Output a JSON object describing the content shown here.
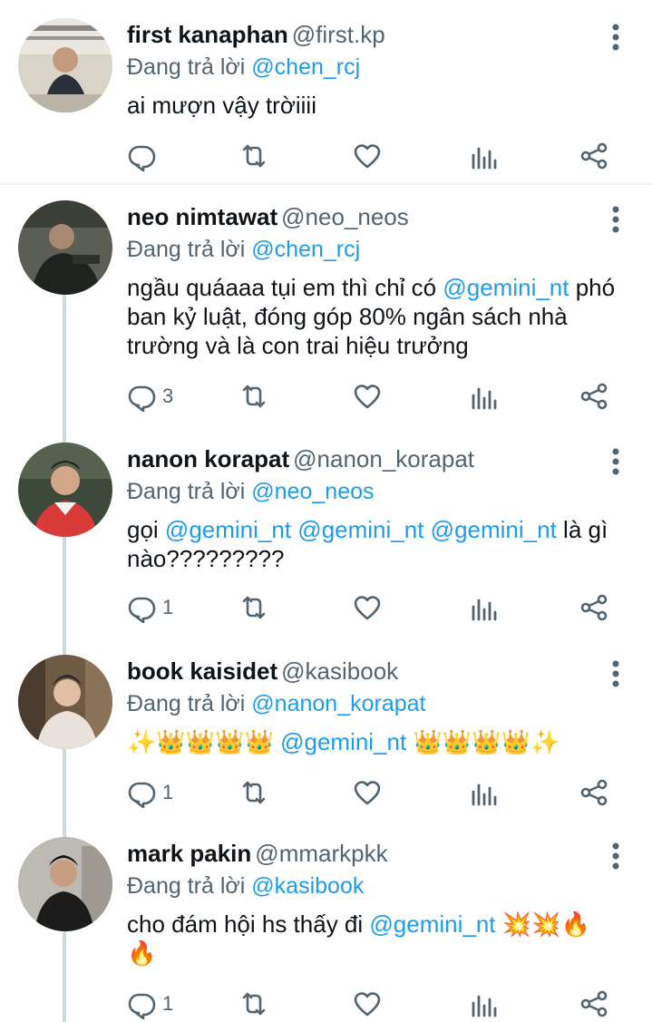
{
  "reply_prefix": "Đang trả lời",
  "tweets": [
    {
      "name": "first kanaphan",
      "handle": "@first.kp",
      "replying_to": "@chen_rcj",
      "text_parts": [
        {
          "t": "ai mượn vậy trờiiii",
          "m": false
        }
      ],
      "reply_count": "",
      "avatar_colors": [
        "#d9d4c8",
        "#2b2f3a"
      ]
    },
    {
      "name": "neo nimtawat",
      "handle": "@neo_neos",
      "replying_to": "@chen_rcj",
      "text_parts": [
        {
          "t": "ngầu quáaaa tụi em thì chỉ có ",
          "m": false
        },
        {
          "t": "@gemini_nt",
          "m": true
        },
        {
          "t": " phó ban kỷ luật, đóng góp 80% ngân sách nhà trường và là con trai hiệu trưởng",
          "m": false
        }
      ],
      "reply_count": "3",
      "avatar_colors": [
        "#5b5e55",
        "#1f2320"
      ]
    },
    {
      "name": "nanon korapat",
      "handle": "@nanon_korapat",
      "replying_to": "@neo_neos",
      "text_parts": [
        {
          "t": "gọi ",
          "m": false
        },
        {
          "t": "@gemini_nt",
          "m": true
        },
        {
          "t": " ",
          "m": false
        },
        {
          "t": "@gemini_nt",
          "m": true
        },
        {
          "t": " ",
          "m": false
        },
        {
          "t": "@gemini_nt",
          "m": true
        },
        {
          "t": " là gì nào?????????",
          "m": false
        }
      ],
      "reply_count": "1",
      "avatar_colors": [
        "#3d4a3a",
        "#d93a3a"
      ]
    },
    {
      "name": "book kaisidet",
      "handle": "@kasibook",
      "replying_to": "@nanon_korapat",
      "text_parts": [
        {
          "t": "✨👑👑👑👑 ",
          "m": false
        },
        {
          "t": "@gemini_nt",
          "m": true
        },
        {
          "t": " 👑👑👑👑✨",
          "m": false
        }
      ],
      "reply_count": "1",
      "avatar_colors": [
        "#6f5a44",
        "#e8e2da"
      ]
    },
    {
      "name": "mark pakin",
      "handle": "@mmarkpkk",
      "replying_to": "@kasibook",
      "text_parts": [
        {
          "t": "cho đám hội hs thấy đi ",
          "m": false
        },
        {
          "t": "@gemini_nt",
          "m": true
        },
        {
          "t": " 💥💥🔥🔥",
          "m": false
        }
      ],
      "reply_count": "1",
      "avatar_colors": [
        "#c9c7c2",
        "#1c1c1c"
      ]
    }
  ],
  "icons": {
    "reply": "reply-icon",
    "retweet": "retweet-icon",
    "like": "heart-icon",
    "views": "bar-chart-icon",
    "share": "share-icon",
    "more": "more-vertical-icon"
  },
  "colors": {
    "mention": "#1d9bf0",
    "secondary_text": "#536471",
    "icon": "#536471",
    "thread_line": "#cfd9de"
  }
}
